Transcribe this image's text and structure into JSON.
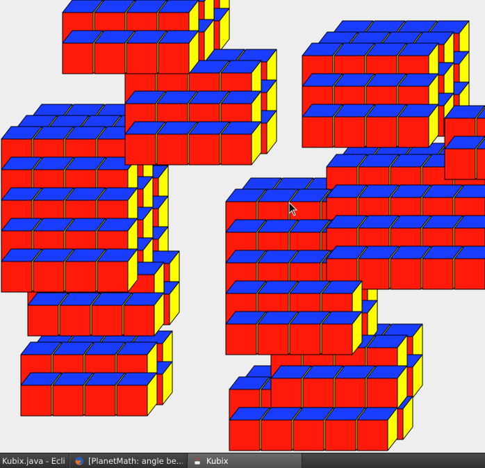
{
  "app": {
    "title": "Kubix"
  },
  "scene": {
    "colors": {
      "top": "#1a3cff",
      "left": "#ff1a0a",
      "right": "#ffff00",
      "outline": "#000000",
      "background": "#eeeeee"
    }
  },
  "taskbar": {
    "tasks": [
      {
        "label": "Kubix.java - Ecli...",
        "icon": "eclipse-icon",
        "active": false
      },
      {
        "label": "[PlanetMath: angle be...",
        "icon": "firefox-icon",
        "active": false
      },
      {
        "label": "Kubix",
        "icon": "java-icon",
        "active": true
      }
    ]
  }
}
